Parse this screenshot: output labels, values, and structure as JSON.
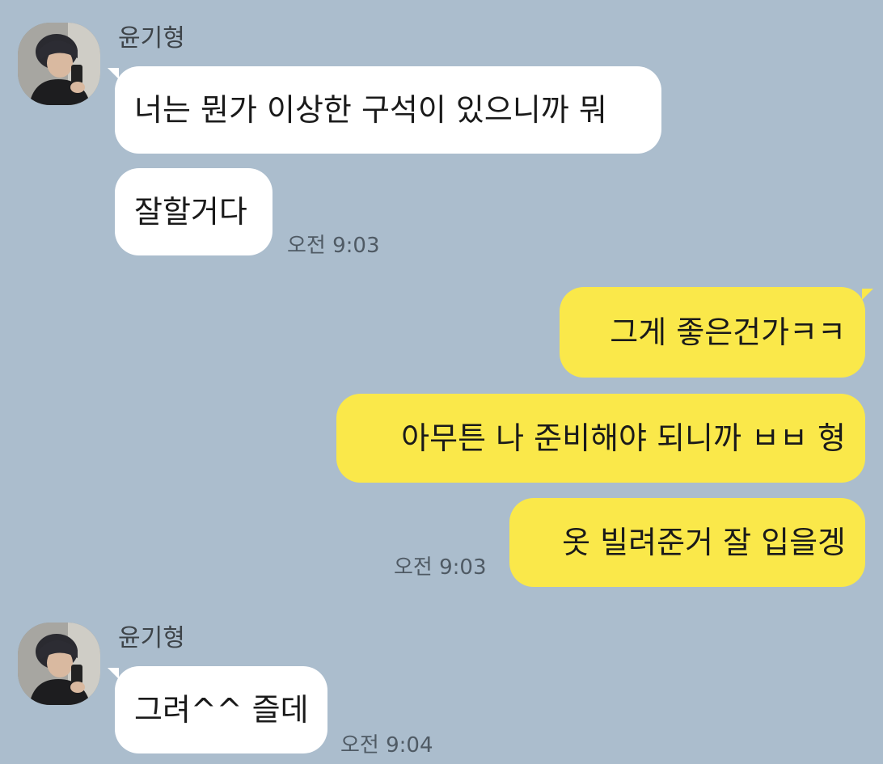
{
  "chat": {
    "groups": [
      {
        "direction": "incoming",
        "sender": "윤기형",
        "avatar_icon": "profile-photo",
        "messages": [
          "너는 뭔가 이상한 구석이 있으니까 뭐",
          "잘할거다"
        ],
        "time": "오전 9:03"
      },
      {
        "direction": "outgoing",
        "messages": [
          "그게 좋은건가ㅋㅋ",
          "아무튼 나 준비해야 되니까 ㅂㅂ 형",
          "옷 빌려준거 잘 입을겡"
        ],
        "time": "오전 9:03"
      },
      {
        "direction": "incoming",
        "sender": "윤기형",
        "avatar_icon": "profile-photo",
        "messages": [
          "그려^^ 즐데"
        ],
        "time": "오전 9:04"
      }
    ]
  },
  "colors": {
    "background": "#abbdcd",
    "incoming_bubble": "#ffffff",
    "outgoing_bubble": "#fae84a",
    "text": "#1a1a1a",
    "meta_text": "#4f5a64"
  }
}
